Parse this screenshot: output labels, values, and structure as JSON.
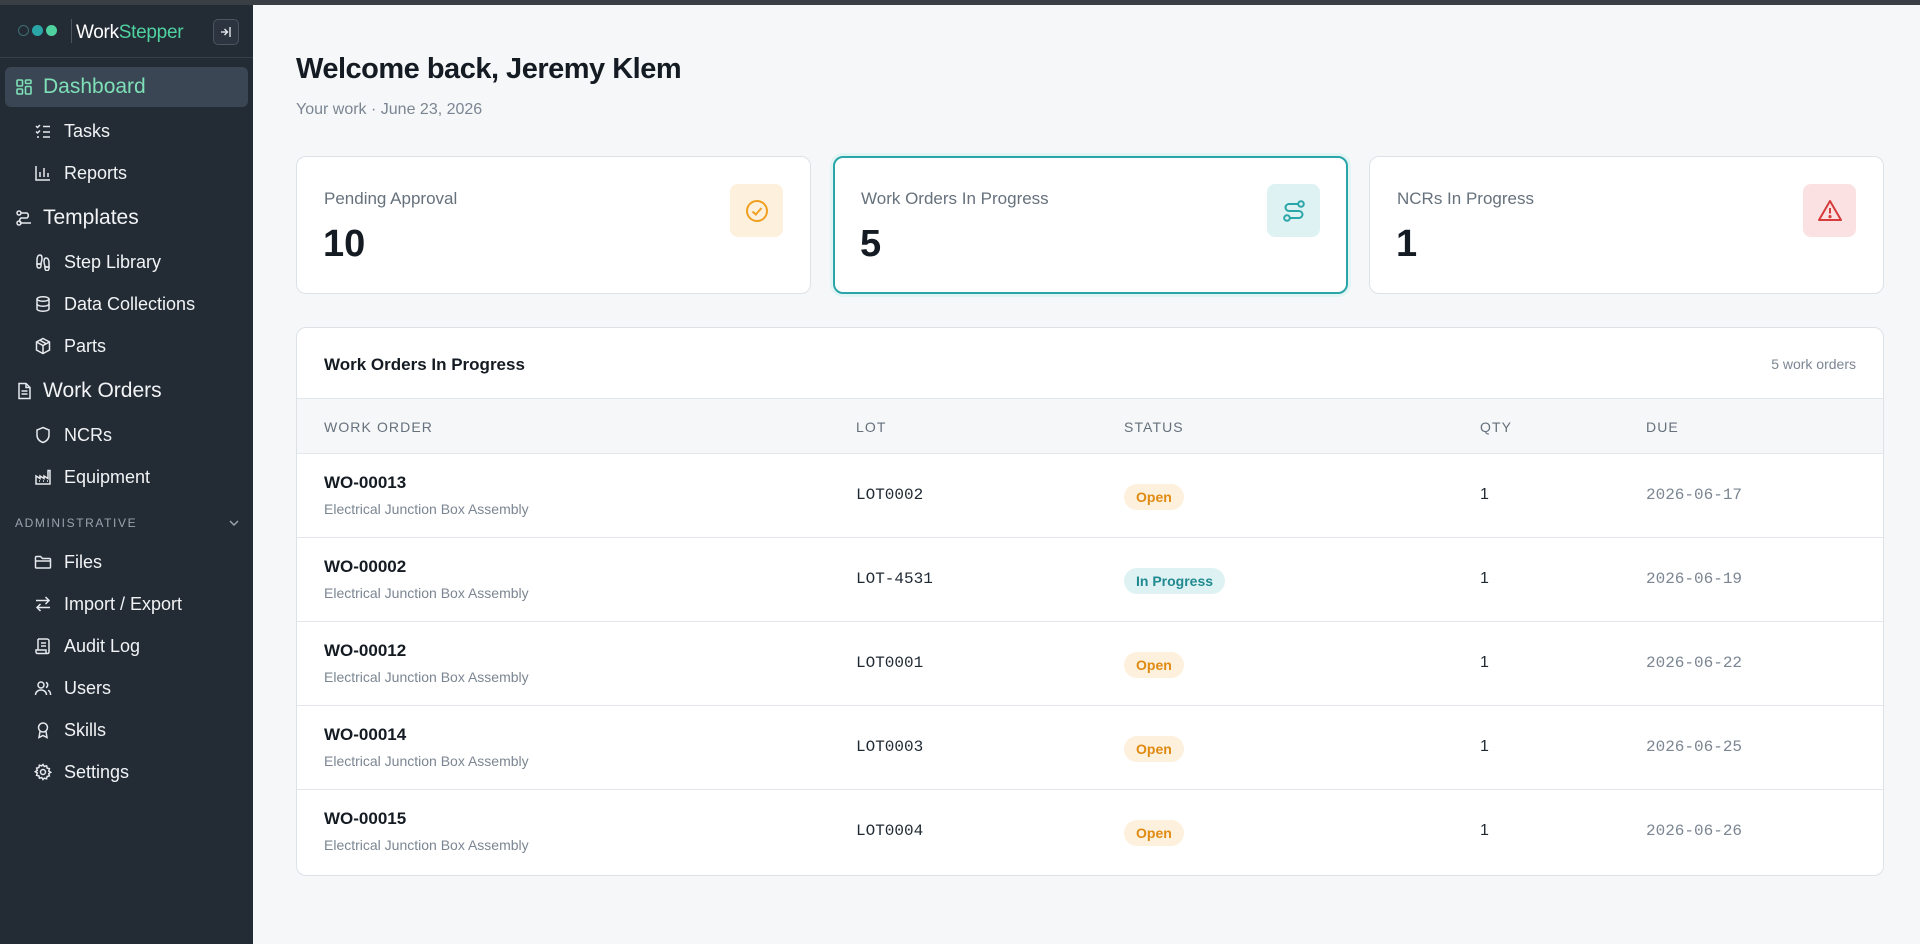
{
  "brand": {
    "part1": "Work",
    "part2": "Stepper"
  },
  "sidebar": {
    "dashboard": "Dashboard",
    "tasks": "Tasks",
    "reports": "Reports",
    "templates": "Templates",
    "step_library": "Step Library",
    "data_collections": "Data Collections",
    "parts": "Parts",
    "work_orders": "Work Orders",
    "ncrs": "NCRs",
    "equipment": "Equipment",
    "admin_section": "ADMINISTRATIVE",
    "files": "Files",
    "import_export": "Import / Export",
    "audit_log": "Audit Log",
    "users": "Users",
    "skills": "Skills",
    "settings": "Settings",
    "active_color": "#7fe0b8"
  },
  "header": {
    "welcome": "Welcome back, Jeremy Klem",
    "subtitle": "Your work · June 23, 2026"
  },
  "stats": [
    {
      "label": "Pending Approval",
      "value": "10",
      "icon": "check-circle-icon",
      "color": "#f0a020"
    },
    {
      "label": "Work Orders In Progress",
      "value": "5",
      "icon": "route-icon",
      "color": "#2aa5a8"
    },
    {
      "label": "NCRs In Progress",
      "value": "1",
      "icon": "warning-triangle-icon",
      "color": "#d63c3c"
    }
  ],
  "table": {
    "title": "Work Orders In Progress",
    "count": "5 work orders",
    "headers": {
      "work_order": "WORK ORDER",
      "lot": "LOT",
      "status": "STATUS",
      "qty": "QTY",
      "due": "DUE"
    },
    "rows": [
      {
        "id": "WO-00013",
        "desc": "Electrical Junction Box Assembly",
        "lot": "LOT0002",
        "status": "Open",
        "qty": "1",
        "due": "2026-06-17"
      },
      {
        "id": "WO-00002",
        "desc": "Electrical Junction Box Assembly",
        "lot": "LOT-4531",
        "status": "In Progress",
        "qty": "1",
        "due": "2026-06-19"
      },
      {
        "id": "WO-00012",
        "desc": "Electrical Junction Box Assembly",
        "lot": "LOT0001",
        "status": "Open",
        "qty": "1",
        "due": "2026-06-22"
      },
      {
        "id": "WO-00014",
        "desc": "Electrical Junction Box Assembly",
        "lot": "LOT0003",
        "status": "Open",
        "qty": "1",
        "due": "2026-06-25"
      },
      {
        "id": "WO-00015",
        "desc": "Electrical Junction Box Assembly",
        "lot": "LOT0004",
        "status": "Open",
        "qty": "1",
        "due": "2026-06-26"
      }
    ]
  }
}
